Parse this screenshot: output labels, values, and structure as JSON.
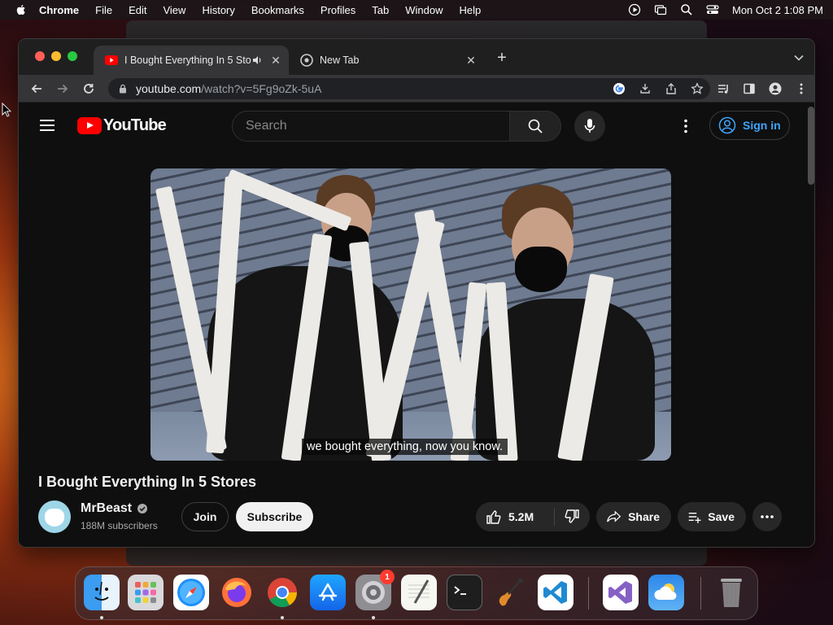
{
  "menubar": {
    "app_name": "Chrome",
    "items": [
      "File",
      "Edit",
      "View",
      "History",
      "Bookmarks",
      "Profiles",
      "Tab",
      "Window",
      "Help"
    ],
    "clock": "Mon Oct 2  1:08 PM"
  },
  "browser": {
    "tabs": [
      {
        "title": "I Bought Everything In 5 Stores",
        "active": true,
        "audio": true
      },
      {
        "title": "New Tab",
        "active": false
      }
    ],
    "url_domain": "youtube.com",
    "url_path": "/watch?v=5Fg9oZk-5uA"
  },
  "youtube": {
    "logo_text": "YouTube",
    "search_placeholder": "Search",
    "signin_label": "Sign in",
    "video": {
      "caption": "we bought everything, now you know.",
      "title": "I Bought Everything In 5 Stores",
      "channel": "MrBeast",
      "subscribers": "188M subscribers",
      "join_label": "Join",
      "subscribe_label": "Subscribe",
      "likes": "5.2M",
      "share_label": "Share",
      "save_label": "Save"
    }
  },
  "dock": {
    "apps": [
      "Finder",
      "Launchpad",
      "Safari",
      "Firefox",
      "Chrome",
      "App Store",
      "System Settings",
      "TextEdit",
      "Terminal",
      "GarageBand",
      "Visual Studio Code",
      "Visual Studio",
      "Weather",
      "Trash"
    ],
    "settings_badge": "1"
  },
  "colors": {
    "yt_red": "#ff0000",
    "link_blue": "#3ea6ff",
    "bg_dark": "#0f0f0f"
  }
}
